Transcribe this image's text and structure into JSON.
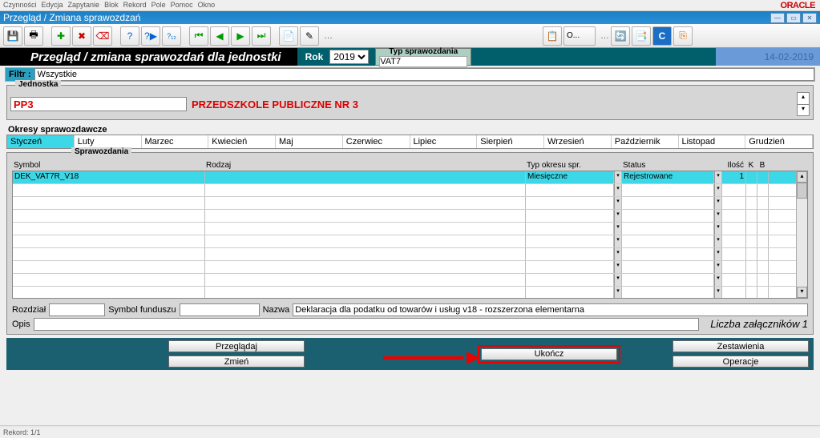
{
  "menubar": [
    "Czynności",
    "Edycja",
    "Zapytanie",
    "Blok",
    "Rekord",
    "Pole",
    "Pomoc",
    "Okno"
  ],
  "oracle": "ORACLE",
  "window_title": "Przegląd / Zmiana sprawozdzań",
  "header": {
    "title": "Przegląd / zmiana  sprawozdań dla jednostki",
    "rok_label": "Rok",
    "rok_value": "2019",
    "typ_label": "Typ sprawozdania",
    "typ_value": "VAT7",
    "date": "14-02-2019"
  },
  "filtr": {
    "label": "Filtr :",
    "value": "Wszystkie"
  },
  "jednostka": {
    "group_label": "Jednostka",
    "code": "PP3",
    "name": "PRZEDSZKOLE PUBLICZNE NR 3"
  },
  "okresy": {
    "label": "Okresy sprawozdawcze",
    "months": [
      "Styczeń",
      "Luty",
      "Marzec",
      "Kwiecień",
      "Maj",
      "Czerwiec",
      "Lipiec",
      "Sierpień",
      "Wrzesień",
      "Październik",
      "Listopad",
      "Grudzień"
    ],
    "selected": 0
  },
  "spraw": {
    "label": "Sprawozdania",
    "columns": {
      "symbol": "Symbol",
      "rodzaj": "Rodzaj",
      "typ": "Typ okresu spr.",
      "status": "Status",
      "ilosc": "Ilość",
      "k": "K",
      "b": "B"
    },
    "rows": [
      {
        "symbol": "DEK_VAT7R_V18",
        "rodzaj": "",
        "typ": "Miesięczne",
        "status": "Rejestrowane",
        "ilosc": "1",
        "k": "",
        "b": ""
      }
    ]
  },
  "bottom": {
    "rozdzial_label": "Rozdział",
    "rozdzial": "",
    "symbolf_label": "Symbol funduszu",
    "symbolf": "",
    "nazwa_label": "Nazwa",
    "nazwa": "Deklaracja dla podatku od towarów i usług v18 - rozszerzona elementarna",
    "opis_label": "Opis",
    "opis": "",
    "liczba_label": "Liczba załączników",
    "liczba": "1"
  },
  "actions": {
    "przegladaj": "Przeglądaj",
    "zmien": "Zmień",
    "ukoncz": "Ukończ",
    "zestawienia": "Zestawienia",
    "operacje": "Operacje"
  },
  "status": {
    "rekord": "Rekord: 1/1"
  },
  "toolbar_search": "O..."
}
